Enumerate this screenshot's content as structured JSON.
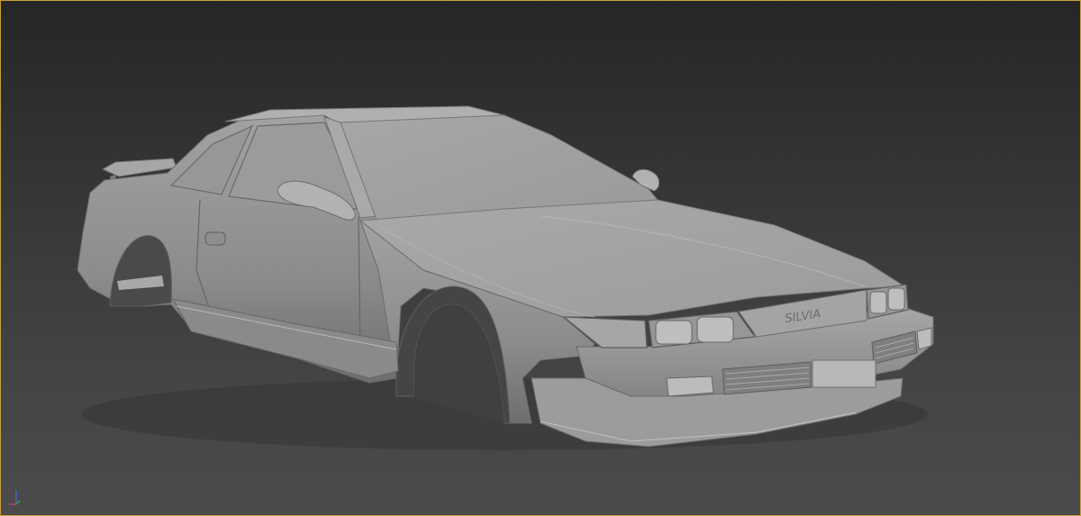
{
  "viewport": {
    "background_top": "#262626",
    "background_bottom": "#4b4b4b",
    "border_color": "#c7a13a",
    "model_color": "#9a9a9a"
  },
  "model": {
    "badge_text": "SILVIA"
  },
  "gizmo": {
    "icon": "axis-tripod-icon",
    "x_color": "#d04a4a",
    "y_color": "#4aa84a",
    "z_color": "#4a6fd0"
  }
}
